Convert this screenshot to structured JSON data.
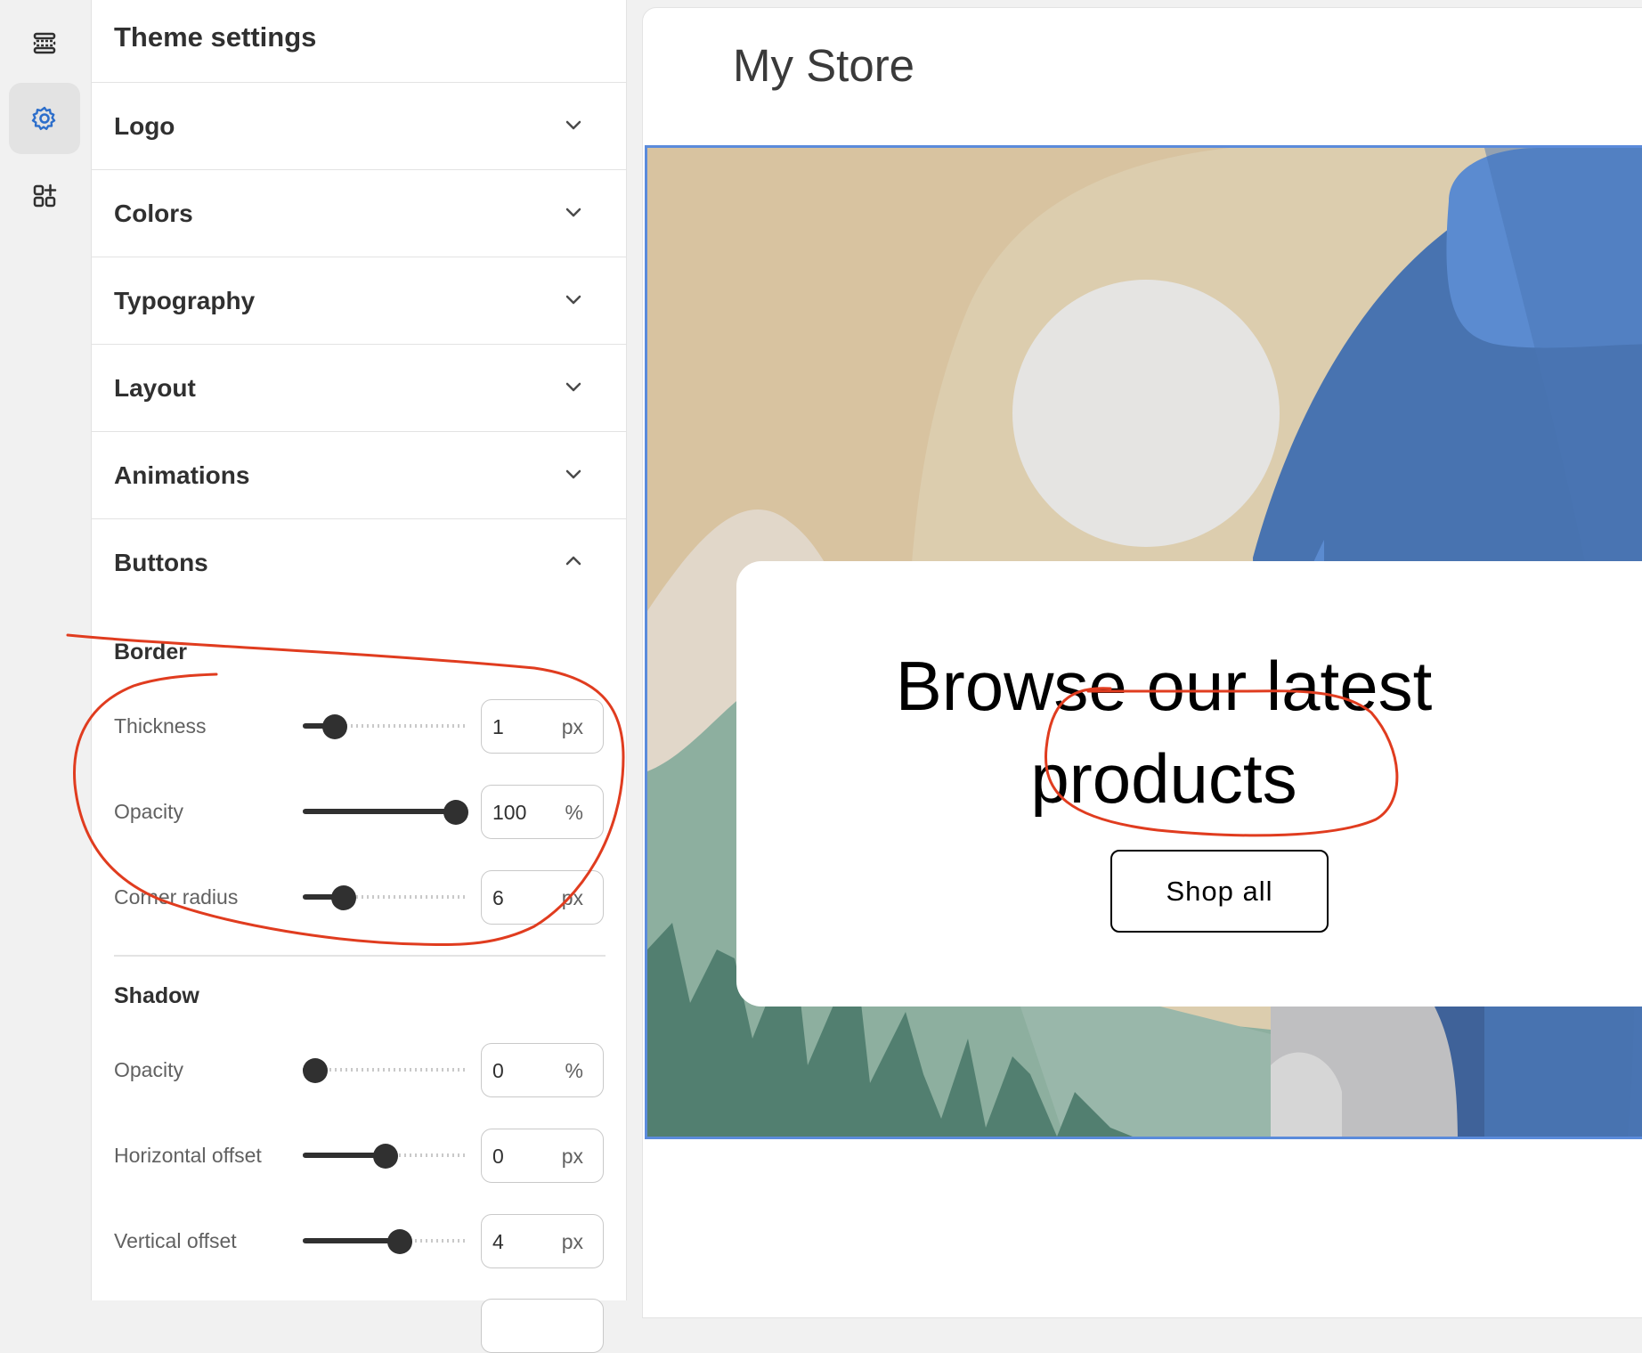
{
  "sidebar": {
    "title": "Theme settings",
    "sections": [
      {
        "label": "Logo",
        "expanded": false
      },
      {
        "label": "Colors",
        "expanded": false
      },
      {
        "label": "Typography",
        "expanded": false
      },
      {
        "label": "Layout",
        "expanded": false
      },
      {
        "label": "Animations",
        "expanded": false
      },
      {
        "label": "Buttons",
        "expanded": true
      }
    ],
    "buttons": {
      "border": {
        "heading": "Border",
        "thickness": {
          "label": "Thickness",
          "value": "1",
          "unit": "px",
          "level": 0.14
        },
        "opacity": {
          "label": "Opacity",
          "value": "100",
          "unit": "%",
          "level": 1.0
        },
        "corner_radius": {
          "label": "Corner radius",
          "value": "6",
          "unit": "px",
          "level": 0.2
        }
      },
      "shadow": {
        "heading": "Shadow",
        "opacity": {
          "label": "Opacity",
          "value": "0",
          "unit": "%",
          "level": 0.0
        },
        "horizontal_offset": {
          "label": "Horizontal offset",
          "value": "0",
          "unit": "px",
          "level": 0.5
        },
        "vertical_offset": {
          "label": "Vertical offset",
          "value": "4",
          "unit": "px",
          "level": 0.6
        }
      }
    }
  },
  "preview": {
    "store_name": "My Store",
    "headline": "Browse our latest products",
    "cta": "Shop all"
  },
  "colors": {
    "accent": "#2c6ecb",
    "annotation": "#e03c1f",
    "hero_border": "#5b8bdb"
  },
  "icons": [
    "sections-icon",
    "theme-settings-gear-icon",
    "add-app-block-icon",
    "chevron-down-icon",
    "chevron-up-icon"
  ]
}
